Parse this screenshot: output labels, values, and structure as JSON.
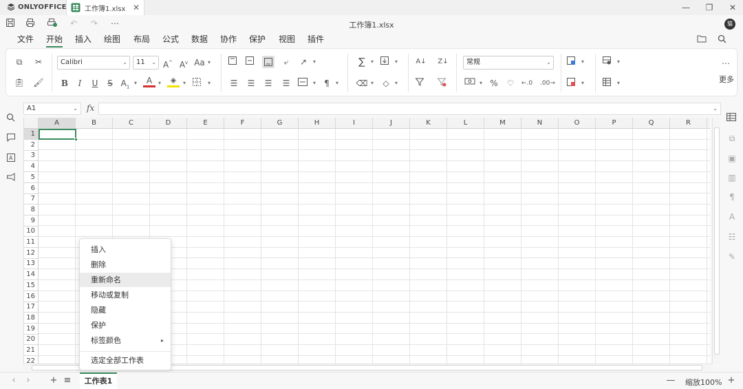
{
  "titlebar": {
    "brand": "ONLYOFFICE",
    "tab_title": "工作簿1.xlsx",
    "doc_title": "工作簿1.xlsx",
    "avatar_initial": "猫"
  },
  "menu": {
    "items": [
      "文件",
      "开始",
      "插入",
      "绘图",
      "布局",
      "公式",
      "数据",
      "协作",
      "保护",
      "视图",
      "插件"
    ],
    "active": "开始"
  },
  "ribbon": {
    "font_name": "Calibri",
    "font_size": "11",
    "number_format": "常规",
    "more_label": "更多",
    "font_color": "#d32f2f",
    "fill_color": "#f5e000"
  },
  "formula_bar": {
    "name_box": "A1",
    "fx": "fx",
    "formula": ""
  },
  "grid": {
    "columns": [
      "A",
      "B",
      "C",
      "D",
      "E",
      "F",
      "G",
      "H",
      "I",
      "J",
      "K",
      "L",
      "M",
      "N",
      "O",
      "P",
      "Q",
      "R"
    ],
    "rows": [
      "1",
      "2",
      "3",
      "4",
      "5",
      "6",
      "7",
      "8",
      "9",
      "10",
      "11",
      "12",
      "13",
      "14",
      "15",
      "16",
      "17",
      "18",
      "19",
      "20",
      "21",
      "22"
    ],
    "selected_cell": "A1"
  },
  "context_menu": {
    "items": [
      "插入",
      "删除",
      "重新命名",
      "移动或复制",
      "隐藏",
      "保护",
      "标签颜色",
      "选定全部工作表"
    ],
    "highlighted": "重新命名"
  },
  "statusbar": {
    "sheet_tab": "工作表1",
    "zoom": "缩放100%"
  },
  "accent_color": "#3a8a5c"
}
